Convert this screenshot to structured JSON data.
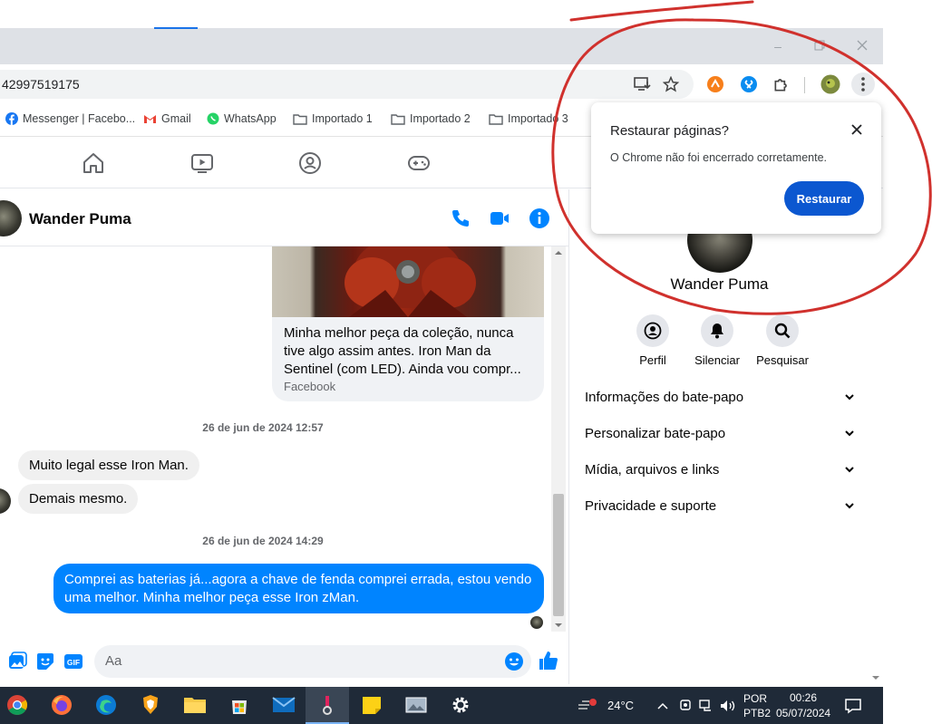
{
  "browser": {
    "url": "42997519175",
    "bookmarks": [
      "Messenger | Facebo...",
      "Gmail",
      "WhatsApp",
      "Importado 1",
      "Importado 2",
      "Importado 3"
    ]
  },
  "chat": {
    "contact_name": "Wander Puma",
    "shared_post": {
      "text": "Minha melhor peça da coleção, nunca tive algo assim antes. Iron Man da Sentinel (com LED). Ainda vou compr...",
      "source": "Facebook"
    },
    "timestamp_1": "26 de jun de 2024 12:57",
    "incoming": [
      "Muito legal esse Iron Man.",
      "Demais mesmo."
    ],
    "timestamp_2": "26 de jun de 2024 14:29",
    "outgoing": "Comprei as baterias já...agora a chave de fenda comprei errada, estou vendo uma melhor. Minha melhor peça esse Iron zMan.",
    "composer_placeholder": "Aa"
  },
  "right_panel": {
    "name": "Wander Puma",
    "actions": [
      "Perfil",
      "Silenciar",
      "Pesquisar"
    ],
    "sections": [
      "Informações do bate-papo",
      "Personalizar bate-papo",
      "Mídia, arquivos e links",
      "Privacidade e suporte"
    ]
  },
  "popup": {
    "title": "Restaurar páginas?",
    "body": "O Chrome não foi encerrado corretamente.",
    "button": "Restaurar"
  },
  "taskbar": {
    "temperature": "24°C",
    "language": "POR",
    "layout": "PTB2",
    "time": "00:26",
    "date": "05/07/2024"
  },
  "colors": {
    "accent": "#0084ff",
    "restore_button": "#0b57d0",
    "annotation": "#d0312d",
    "taskbar": "#1f2a38"
  }
}
